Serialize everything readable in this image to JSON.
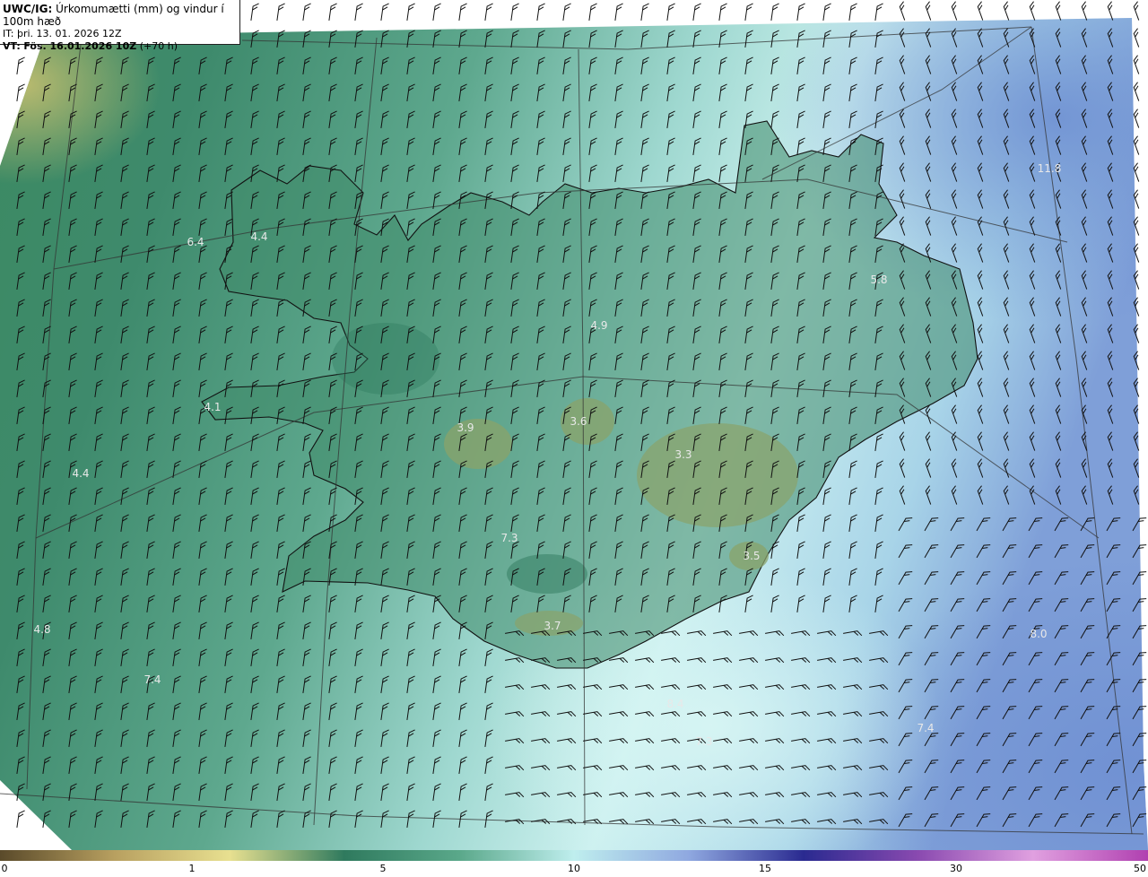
{
  "header": {
    "model": "UWC/IG:",
    "title": "Úrkomumætti (mm) og vindur í 100m hæð",
    "init_prefix": "IT:",
    "init_time": "þri. 13. 01. 2026 12Z",
    "valid_prefix": "VT:",
    "valid_time": "Fös. 16.01.2026 10Z",
    "lead_time": "(+70 h)"
  },
  "colorbar": {
    "ticks": [
      "0",
      "1",
      "5",
      "10",
      "15",
      "30",
      "50"
    ],
    "colors": [
      "#5a4a2a",
      "#b8a060",
      "#e8e090",
      "#2f7a5e",
      "#5aa88a",
      "#bfeeee",
      "#8fa8e0",
      "#2a2a90",
      "#8a4ab0",
      "#e0a0e0",
      "#b040b0"
    ]
  },
  "value_labels": [
    {
      "text": "6.4"
    },
    {
      "text": "4.4"
    },
    {
      "text": "4.1"
    },
    {
      "text": "4.4"
    },
    {
      "text": "4.8"
    },
    {
      "text": "7.4"
    },
    {
      "text": "3.9"
    },
    {
      "text": "3.6"
    },
    {
      "text": "4.9"
    },
    {
      "text": "3.3"
    },
    {
      "text": "7.3"
    },
    {
      "text": "3.5"
    },
    {
      "text": "3.7"
    },
    {
      "text": "5.8"
    },
    {
      "text": "11.8"
    },
    {
      "text": "8.0"
    },
    {
      "text": "7.4"
    },
    {
      "text": "7.3"
    },
    {
      "text": "8.4"
    }
  ],
  "colors": {
    "field_low": "#2e7a5f",
    "field_mid": "#5ea88e",
    "field_high": "#cdf1f0",
    "field_blue": "#7f9fd8",
    "land_high": "#8aa36a",
    "coast": "#111111",
    "barb": "#111111"
  }
}
